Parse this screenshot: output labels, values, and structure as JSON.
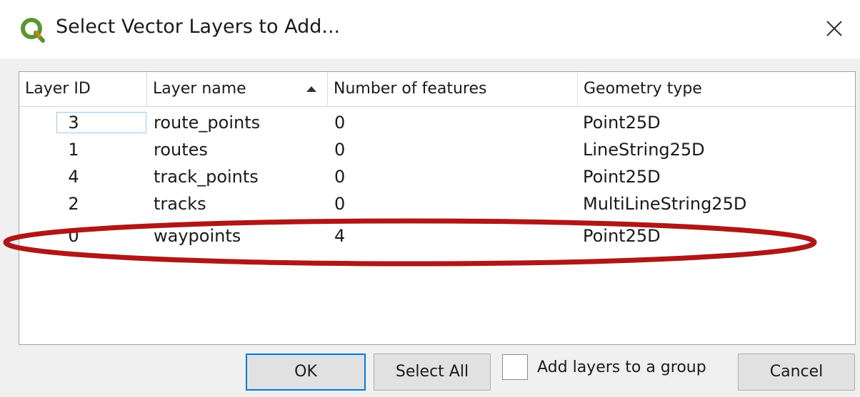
{
  "window": {
    "title": "Select Vector Layers to Add...",
    "close_label": "×"
  },
  "table": {
    "headers": [
      "Layer ID",
      "Layer name",
      "Number of features",
      "Geometry type"
    ],
    "sort_column": "Layer name",
    "sort_direction": "ascending",
    "rows": [
      {
        "id": "3",
        "name": "route_points",
        "features": "0",
        "geometry": "Point25D"
      },
      {
        "id": "1",
        "name": "routes",
        "features": "0",
        "geometry": "LineString25D"
      },
      {
        "id": "4",
        "name": "track_points",
        "features": "0",
        "geometry": "Point25D"
      },
      {
        "id": "2",
        "name": "tracks",
        "features": "0",
        "geometry": "MultiLineString25D"
      },
      {
        "id": "0",
        "name": "waypoints",
        "features": "4",
        "geometry": "Point25D"
      }
    ]
  },
  "buttons": {
    "ok": "OK",
    "select_all": "Select All",
    "cancel": "Cancel"
  },
  "options": {
    "add_to_group_label": "Add layers to a group",
    "add_to_group_checked": false
  },
  "annotation": {
    "color": "#b01616"
  },
  "icons": {
    "app": "qgis-logo-icon",
    "close": "close-icon",
    "sort": "sort-ascending-icon"
  }
}
